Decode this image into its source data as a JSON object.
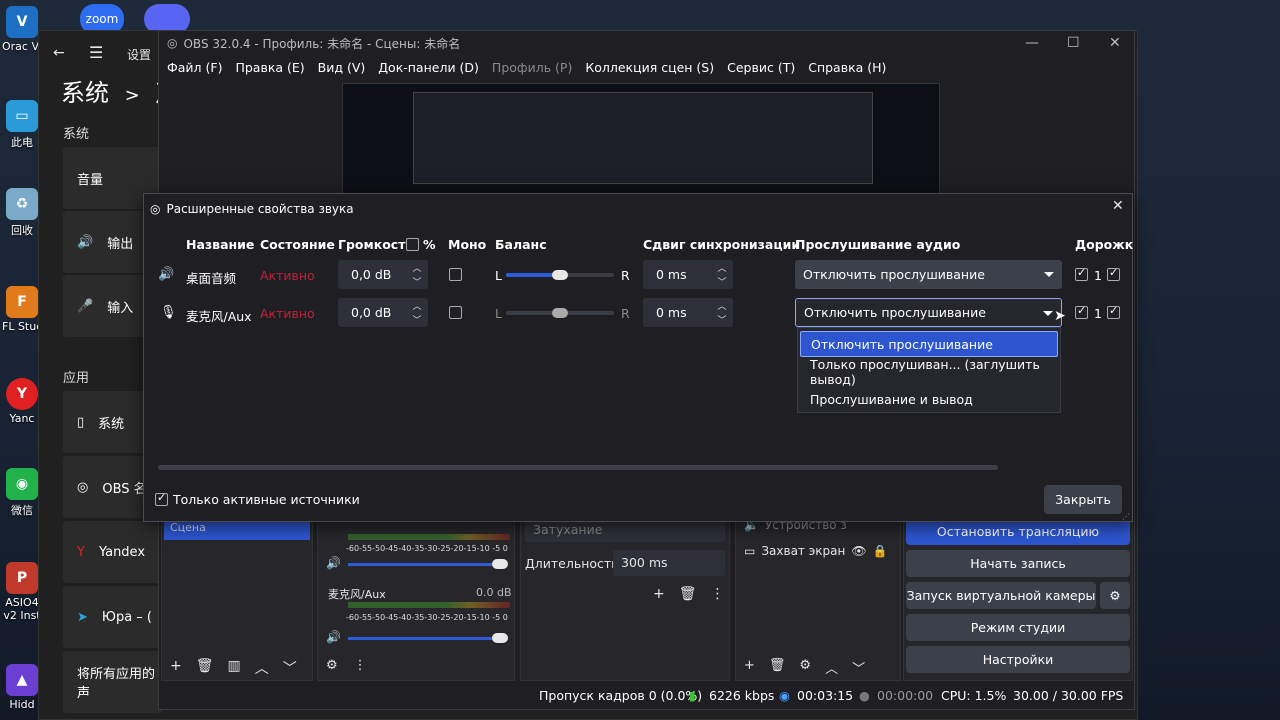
{
  "desktop": {
    "icons": [
      {
        "label": "Orac Virtua",
        "icon": "virtualbox-icon",
        "color": "#1d6fc4"
      },
      {
        "label": "此电",
        "icon": "computer-icon",
        "color": "#2a9bd6"
      },
      {
        "label": "回收",
        "icon": "recycle-bin-icon",
        "color": "#7aa9c9"
      },
      {
        "label": "FL Studi",
        "icon": "flstudio-icon",
        "color": "#e07a1a"
      },
      {
        "label": "Yanc",
        "icon": "yandex-icon",
        "color": "#e02020"
      },
      {
        "label": "微信",
        "icon": "wechat-icon",
        "color": "#22b24c"
      },
      {
        "label": "ASIO4 v2 Inst",
        "icon": "pdf-icon",
        "color": "#c0392b"
      },
      {
        "label": "Hidd",
        "icon": "hidden-icon",
        "color": "#6b3fd1"
      }
    ],
    "top_apps": [
      "zoom",
      ""
    ]
  },
  "settings": {
    "back_icon": "arrow-left-icon",
    "menu_icon": "hamburger-icon",
    "title": "设置",
    "breadcrumb_root": "系统",
    "breadcrumb_sep": ">",
    "breadcrumb_child": "声",
    "section_system": "系统",
    "rows_system": [
      "音量",
      "输出",
      "输入"
    ],
    "section_apps": "应用",
    "rows_apps": [
      "系统",
      "OBS 名",
      "Yandex",
      "Юра – (",
      "将所有应用的声"
    ]
  },
  "obs": {
    "title": "OBS 32.0.4 - Профиль: 未命名 - Сцены: 未命名",
    "menu": [
      "Файл (F)",
      "Правка (E)",
      "Вид (V)",
      "Док-панели (D)",
      "Профиль (P)",
      "Коллекция сцен (S)",
      "Сервис (T)",
      "Справка (H)"
    ],
    "menu_disabled_index": 4,
    "mixer": {
      "scale": "-60-55-50-45-40-35-30-25-20-15-10 -5 0",
      "channel2_name": "麦克风/Aux",
      "channel2_db": "0.0 dB"
    },
    "transitions": {
      "type": "Затухание",
      "duration_label": "Длительность",
      "duration_value": "300 ms"
    },
    "sources": [
      {
        "name": "Устройство з",
        "icon": "speaker-icon"
      },
      {
        "name": "Захват экран",
        "icon": "monitor-icon"
      }
    ],
    "controls": {
      "stop_stream": "Остановить трансляцию",
      "start_record": "Начать запись",
      "virtual_cam": "Запуск виртуальной камеры",
      "studio_mode": "Режим студии",
      "settings": "Настройки"
    },
    "scene_item": "Сцена",
    "status": {
      "dropped": "Пропуск кадров 0 (0.0%)",
      "bitrate": "6226 kbps",
      "stream_time": "00:03:15",
      "record_time": "00:00:00",
      "cpu": "CPU: 1.5%",
      "fps": "30.00 / 30.00 FPS"
    }
  },
  "dialog": {
    "title": "Расширенные свойства звука",
    "headers": {
      "name": "Название",
      "state": "Состояние",
      "volume": "Громкость",
      "percent": "%",
      "mono": "Моно",
      "balance": "Баланс",
      "sync": "Сдвиг синхронизации",
      "monitoring": "Прослушивание аудио",
      "tracks": "Дорожк"
    },
    "rows": [
      {
        "name": "桌面音频",
        "state": "Активно",
        "volume": "0,0 dB",
        "mono": false,
        "bal_left": "L",
        "bal_right": "R",
        "sync": "0 ms",
        "monitor": "Отключить прослушивание",
        "track": "1",
        "icon": "speaker-icon"
      },
      {
        "name": "麦克风/Aux",
        "state": "Активно",
        "volume": "0,0 dB",
        "mono": false,
        "bal_left": "L",
        "bal_right": "R",
        "sync": "0 ms",
        "monitor": "Отключить прослушивание",
        "track": "1",
        "icon": "microphone-icon"
      }
    ],
    "dropdown_options": [
      "Отключить прослушивание",
      "Только прослушиван... (заглушить вывод)",
      "Прослушивание и вывод"
    ],
    "dropdown_selected_index": 0,
    "only_active_label": "Только активные источники",
    "only_active_checked": true,
    "close_label": "Закрыть",
    "state_color": "#c0203a",
    "accent_color": "#2c55cf"
  }
}
